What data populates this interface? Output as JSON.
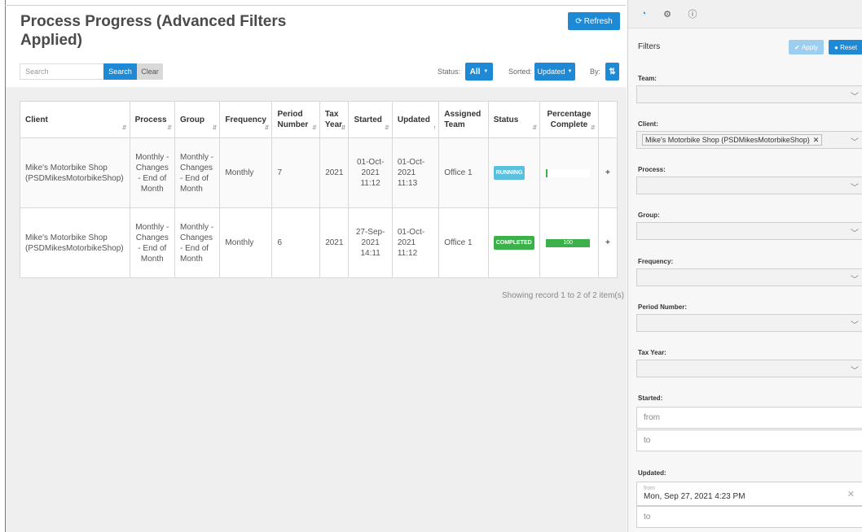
{
  "header": {
    "title": "Process Progress (Advanced Filters Applied)",
    "refresh_label": "Refresh",
    "search_placeholder": "Search",
    "search_label": "Search",
    "clear_label": "Clear",
    "status_label": "Status:",
    "status_value": "All",
    "sorted_label": "Sorted:",
    "sorted_value": "Updated",
    "by_label": "By:"
  },
  "table": {
    "columns": [
      "Client",
      "Process",
      "Group",
      "Frequency",
      "Period Number",
      "Tax Year",
      "Started",
      "Updated",
      "Assigned Team",
      "Status",
      "Percentage Complete"
    ],
    "rows": [
      {
        "client": "Mike's Motorbike Shop (PSDMikesMotorbikeShop)",
        "process": "Monthly - Changes - End of Month",
        "group": "Monthly - Changes - End of Month",
        "frequency": "Monthly",
        "period": "7",
        "tax_year": "2021",
        "started": "01-Oct-2021 11:12",
        "updated": "01-Oct-2021 11:13",
        "team": "Office 1",
        "status": "RUNNING",
        "percent": 0,
        "percent_label": ""
      },
      {
        "client": "Mike's Motorbike Shop (PSDMikesMotorbikeShop)",
        "process": "Monthly - Changes - End of Month",
        "group": "Monthly - Changes - End of Month",
        "frequency": "Monthly",
        "period": "6",
        "tax_year": "2021",
        "started": "27-Sep-2021 14:11",
        "updated": "01-Oct-2021 11:12",
        "team": "Office 1",
        "status": "COMPLETED",
        "percent": 100,
        "percent_label": "100"
      }
    ],
    "record_count": "Showing record 1 to 2 of 2 item(s)"
  },
  "panel": {
    "tabs": [
      "dashboard-icon",
      "gear-icon",
      "info-icon"
    ],
    "filters_title": "Filters",
    "apply_label": "Apply",
    "reset_label": "Reset",
    "team_label": "Team:",
    "client_label": "Client:",
    "client_value": "Mike's Motorbike Shop (PSDMikesMotorbikeShop)",
    "process_label": "Process:",
    "group_label": "Group:",
    "frequency_label": "Frequency:",
    "period_label": "Period Number:",
    "taxyear_label": "Tax Year:",
    "started_label": "Started:",
    "started_from": "from",
    "started_to": "to",
    "updated_label": "Updated:",
    "updated_from_label": "from",
    "updated_from_value": "Mon, Sep 27, 2021 4:23 PM",
    "updated_to": "to"
  },
  "colors": {
    "primary": "#1e8ad6",
    "running": "#5bc0de",
    "completed": "#3cb04a"
  }
}
